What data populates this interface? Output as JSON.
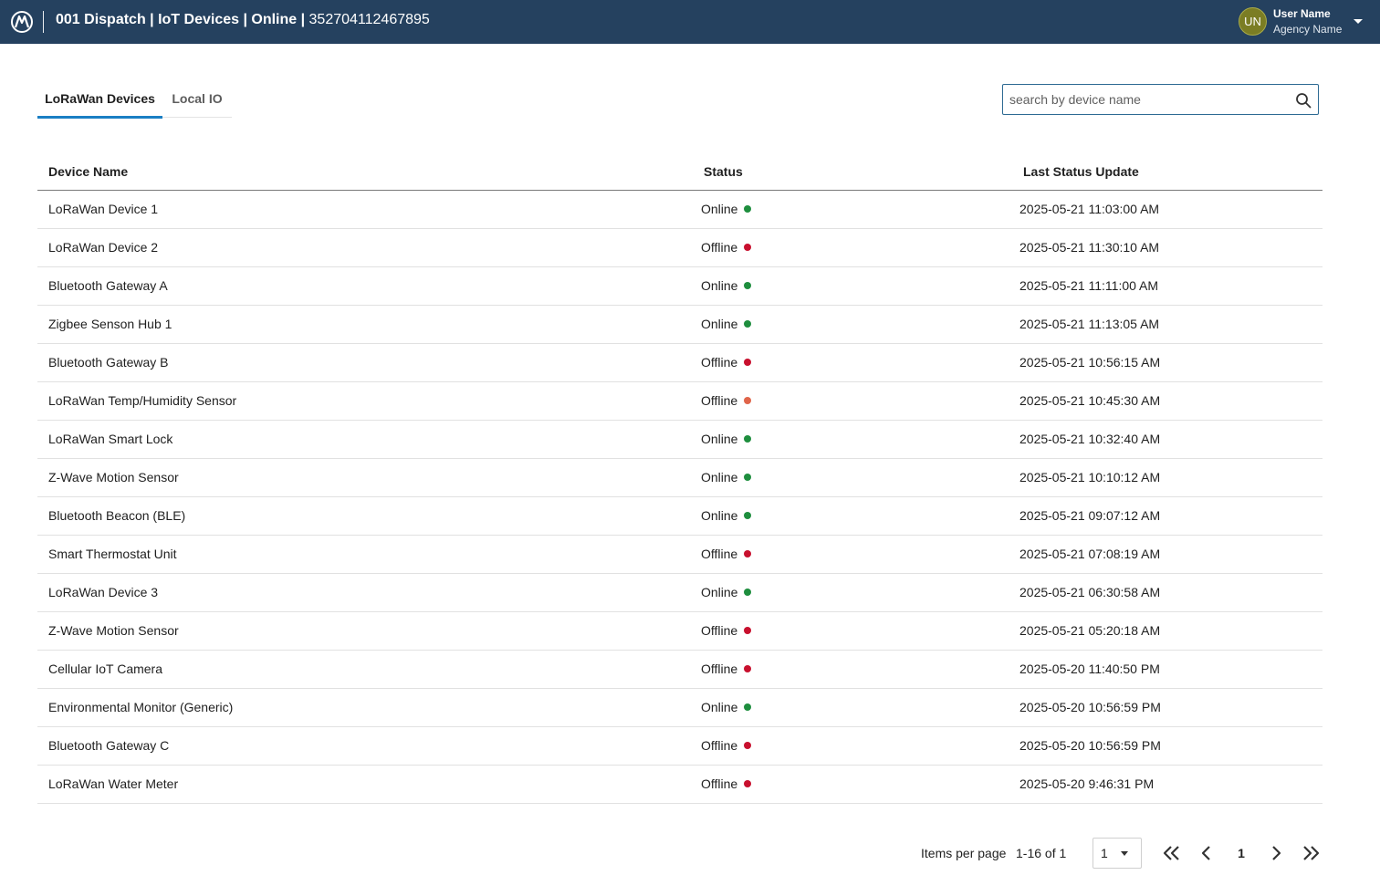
{
  "header": {
    "title_bold": "001 Dispatch | IoT Devices | Online |",
    "device_id": "352704112467895",
    "avatar_initials": "UN",
    "user_name": "User Name",
    "agency_name": "Agency Name",
    "background_color": "#25415f"
  },
  "tabs": [
    {
      "label": "LoRaWan Devices",
      "active": true
    },
    {
      "label": "Local IO",
      "active": false
    }
  ],
  "search": {
    "placeholder": "search by device name",
    "value": "",
    "icon": "search-icon"
  },
  "table": {
    "columns": [
      "Device Name",
      "Status",
      "Last Status Update"
    ],
    "rows": [
      {
        "name": "LoRaWan Device 1",
        "status": "Online",
        "status_color": "#1e8e3e",
        "updated": "2025-05-21 11:03:00 AM"
      },
      {
        "name": "LoRaWan Device 2",
        "status": "Offline",
        "status_color": "#c8102e",
        "updated": "2025-05-21 11:30:10 AM"
      },
      {
        "name": "Bluetooth Gateway A",
        "status": "Online",
        "status_color": "#1e8e3e",
        "updated": "2025-05-21 11:11:00 AM"
      },
      {
        "name": "Zigbee Senson Hub 1",
        "status": "Online",
        "status_color": "#1e8e3e",
        "updated": "2025-05-21 11:13:05 AM"
      },
      {
        "name": "Bluetooth Gateway B",
        "status": "Offline",
        "status_color": "#c8102e",
        "updated": "2025-05-21 10:56:15 AM"
      },
      {
        "name": "LoRaWan Temp/Humidity Sensor",
        "status": "Offline",
        "status_color": "#e0654a",
        "updated": "2025-05-21 10:45:30 AM"
      },
      {
        "name": "LoRaWan Smart Lock",
        "status": "Online",
        "status_color": "#1e8e3e",
        "updated": "2025-05-21 10:32:40 AM"
      },
      {
        "name": "Z-Wave Motion Sensor",
        "status": "Online",
        "status_color": "#1e8e3e",
        "updated": "2025-05-21 10:10:12 AM"
      },
      {
        "name": "Bluetooth Beacon (BLE)",
        "status": "Online",
        "status_color": "#1e8e3e",
        "updated": "2025-05-21 09:07:12 AM"
      },
      {
        "name": "Smart Thermostat Unit",
        "status": "Offline",
        "status_color": "#c8102e",
        "updated": "2025-05-21 07:08:19 AM"
      },
      {
        "name": "LoRaWan Device 3",
        "status": "Online",
        "status_color": "#1e8e3e",
        "updated": "2025-05-21 06:30:58 AM"
      },
      {
        "name": "Z-Wave Motion Sensor",
        "status": "Offline",
        "status_color": "#c8102e",
        "updated": "2025-05-21 05:20:18 AM"
      },
      {
        "name": "Cellular IoT Camera",
        "status": "Offline",
        "status_color": "#c8102e",
        "updated": "2025-05-20 11:40:50 PM"
      },
      {
        "name": "Environmental Monitor (Generic)",
        "status": "Online",
        "status_color": "#1e8e3e",
        "updated": "2025-05-20 10:56:59 PM"
      },
      {
        "name": "Bluetooth Gateway C",
        "status": "Offline",
        "status_color": "#c8102e",
        "updated": "2025-05-20 10:56:59 PM"
      },
      {
        "name": "LoRaWan Water Meter",
        "status": "Offline",
        "status_color": "#c8102e",
        "updated": "2025-05-20 9:46:31 PM"
      }
    ]
  },
  "pagination": {
    "items_per_page_label": "Items per page",
    "range_label": "1-16 of 1",
    "items_per_page_value": "1",
    "current_page": "1"
  }
}
